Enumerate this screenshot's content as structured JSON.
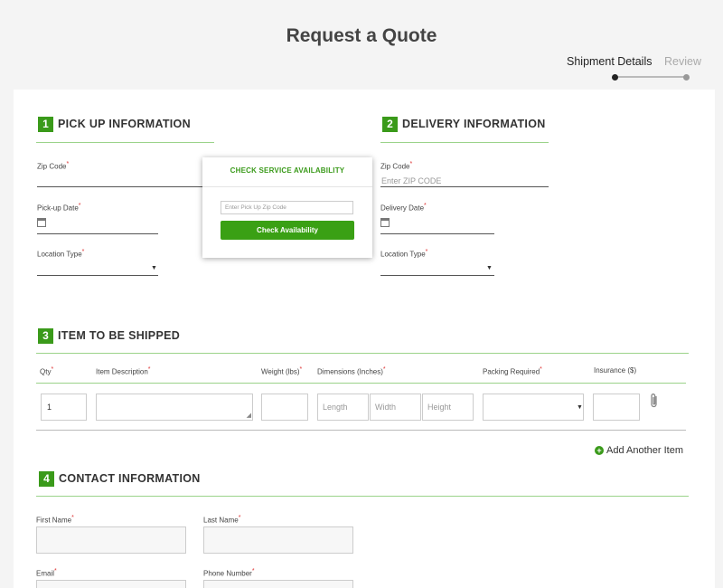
{
  "page": {
    "title": "Request a Quote"
  },
  "steps": {
    "active": "Shipment Details",
    "next": "Review"
  },
  "pickup": {
    "num": "1",
    "title": "PICK UP INFORMATION",
    "zip_label": "Zip Code",
    "date_label": "Pick-up Date",
    "location_label": "Location Type"
  },
  "delivery": {
    "num": "2",
    "title": "DELIVERY INFORMATION",
    "zip_label": "Zip Code",
    "zip_placeholder": "Enter ZIP CODE",
    "date_label": "Delivery Date",
    "location_label": "Location Type"
  },
  "popup": {
    "title": "CHECK SERVICE AVAILABILITY",
    "input_placeholder": "Enter Pick Up Zip Code",
    "button": "Check Availability"
  },
  "items": {
    "num": "3",
    "title": "ITEM TO BE SHIPPED",
    "headers": {
      "qty": "Qty",
      "desc": "Item Description",
      "weight": "Weight (lbs)",
      "dims": "Dimensions (Inches)",
      "packing": "Packing Required",
      "insurance": "Insurance ($)"
    },
    "row": {
      "qty": "1",
      "length_ph": "Length",
      "width_ph": "Width",
      "height_ph": "Height"
    },
    "add_label": "Add Another Item"
  },
  "contact": {
    "num": "4",
    "title": "CONTACT INFORMATION",
    "first_name": "First Name",
    "last_name": "Last Name",
    "email": "Email",
    "phone": "Phone Number"
  },
  "required_mark": "*",
  "colors": {
    "accent": "#3a9a1a",
    "required": "#dd3333"
  }
}
